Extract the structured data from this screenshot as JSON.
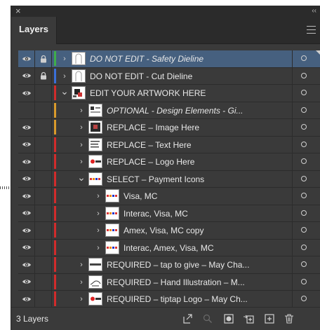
{
  "panel": {
    "title": "Layers",
    "close_glyph": "×",
    "collapse_glyph": "‹‹"
  },
  "layers": [
    {
      "name": "DO NOT EDIT - Safety Dieline",
      "visible": true,
      "locked": true,
      "expandable": true,
      "expanded": false,
      "indent": 0,
      "color": "#3fae4a",
      "italic": true,
      "selected": true,
      "thumb": "dieline"
    },
    {
      "name": "DO NOT EDIT - Cut Dieline",
      "visible": true,
      "locked": true,
      "expandable": true,
      "expanded": false,
      "indent": 0,
      "color": "#3a6fd8",
      "italic": false,
      "selected": false,
      "thumb": "dieline"
    },
    {
      "name": "EDIT YOUR ARTWORK HERE",
      "visible": true,
      "locked": false,
      "expandable": true,
      "expanded": true,
      "indent": 0,
      "color": "#d22b2b",
      "italic": false,
      "selected": false,
      "thumb": "art"
    },
    {
      "name": "OPTIONAL - Design Elements - Gi...",
      "visible": false,
      "locked": false,
      "expandable": true,
      "expanded": false,
      "indent": 1,
      "color": "#d99a2b",
      "italic": true,
      "selected": false,
      "thumb": "design"
    },
    {
      "name": "REPLACE – Image Here",
      "visible": true,
      "locked": false,
      "expandable": true,
      "expanded": false,
      "indent": 1,
      "color": "#d99a2b",
      "italic": false,
      "selected": false,
      "thumb": "image"
    },
    {
      "name": "REPLACE – Text Here",
      "visible": true,
      "locked": false,
      "expandable": true,
      "expanded": false,
      "indent": 1,
      "color": "#d22b2b",
      "italic": false,
      "selected": false,
      "thumb": "text"
    },
    {
      "name": "REPLACE – Logo Here",
      "visible": true,
      "locked": false,
      "expandable": true,
      "expanded": false,
      "indent": 1,
      "color": "#d22b2b",
      "italic": false,
      "selected": false,
      "thumb": "logo"
    },
    {
      "name": "SELECT – Payment Icons",
      "visible": true,
      "locked": false,
      "expandable": true,
      "expanded": true,
      "indent": 1,
      "color": "#d22b2b",
      "italic": false,
      "selected": false,
      "thumb": "payments"
    },
    {
      "name": "Visa, MC",
      "visible": true,
      "locked": false,
      "expandable": true,
      "expanded": false,
      "indent": 2,
      "color": "#d22b2b",
      "italic": false,
      "selected": false,
      "thumb": "payments"
    },
    {
      "name": "Interac, Visa, MC",
      "visible": true,
      "locked": false,
      "expandable": true,
      "expanded": false,
      "indent": 2,
      "color": "#d22b2b",
      "italic": false,
      "selected": false,
      "thumb": "payments"
    },
    {
      "name": "Amex, Visa, MC copy",
      "visible": true,
      "locked": false,
      "expandable": true,
      "expanded": false,
      "indent": 2,
      "color": "#d22b2b",
      "italic": false,
      "selected": false,
      "thumb": "payments"
    },
    {
      "name": "Interac, Amex, Visa, MC",
      "visible": true,
      "locked": false,
      "expandable": true,
      "expanded": false,
      "indent": 2,
      "color": "#d22b2b",
      "italic": false,
      "selected": false,
      "thumb": "payments"
    },
    {
      "name": "REQUIRED – tap to give – May Cha...",
      "visible": true,
      "locked": false,
      "expandable": true,
      "expanded": false,
      "indent": 1,
      "color": "#d22b2b",
      "italic": false,
      "selected": false,
      "thumb": "tap"
    },
    {
      "name": "REQUIRED – Hand Illustration – M...",
      "visible": true,
      "locked": false,
      "expandable": true,
      "expanded": false,
      "indent": 1,
      "color": "#d22b2b",
      "italic": false,
      "selected": false,
      "thumb": "hand"
    },
    {
      "name": "REQUIRED – tiptap Logo – May Ch...",
      "visible": true,
      "locked": false,
      "expandable": true,
      "expanded": false,
      "indent": 1,
      "color": "#d22b2b",
      "italic": false,
      "selected": false,
      "thumb": "logo"
    }
  ],
  "footer": {
    "count_label": "3 Layers",
    "icons": [
      "collect-for-export-icon",
      "locate-object-icon",
      "make-clipping-mask-icon",
      "create-sublayer-icon",
      "create-new-layer-icon",
      "delete-layer-icon"
    ]
  }
}
